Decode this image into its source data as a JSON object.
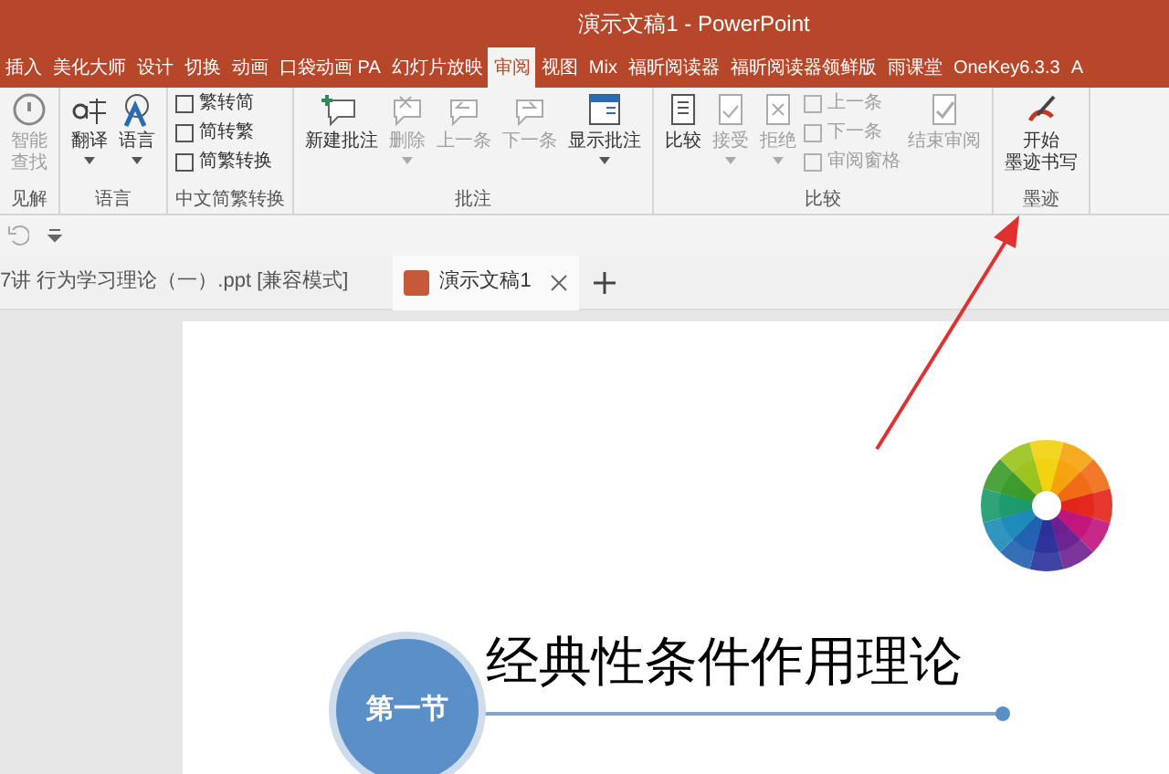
{
  "title_bar": {
    "title": "演示文稿1  -  PowerPoint"
  },
  "ribbon_tabs": [
    {
      "label": "插入",
      "selected": false
    },
    {
      "label": "美化大师",
      "selected": false
    },
    {
      "label": "设计",
      "selected": false
    },
    {
      "label": "切换",
      "selected": false
    },
    {
      "label": "动画",
      "selected": false
    },
    {
      "label": "口袋动画 PA",
      "selected": false
    },
    {
      "label": "幻灯片放映",
      "selected": false
    },
    {
      "label": "审阅",
      "selected": true
    },
    {
      "label": "视图",
      "selected": false
    },
    {
      "label": "Mix",
      "selected": false
    },
    {
      "label": "福昕阅读器",
      "selected": false
    },
    {
      "label": "福昕阅读器领鲜版",
      "selected": false
    },
    {
      "label": "雨课堂",
      "selected": false
    },
    {
      "label": "OneKey6.3.3",
      "selected": false
    },
    {
      "label": "A",
      "selected": false
    }
  ],
  "ribbon_groups": [
    {
      "label": "见解",
      "items": [
        {
          "kind": "large",
          "label_lines": [
            "智能",
            "查找"
          ],
          "disabled": true,
          "has_menu": false
        }
      ]
    },
    {
      "label": "语言",
      "items": [
        {
          "kind": "large",
          "label": "翻译",
          "disabled": false,
          "has_menu": true
        },
        {
          "kind": "large",
          "label": "语言",
          "disabled": false,
          "has_menu": true
        }
      ]
    },
    {
      "label": "中文简繁转换",
      "items": [
        {
          "kind": "small",
          "label": "繁转简",
          "disabled": false
        },
        {
          "kind": "small",
          "label": "简转繁",
          "disabled": false
        },
        {
          "kind": "small",
          "label": "简繁转换",
          "disabled": false
        }
      ]
    },
    {
      "label": "批注",
      "items": [
        {
          "kind": "large",
          "label": "新建批注",
          "disabled": false,
          "has_menu": false
        },
        {
          "kind": "large",
          "label": "删除",
          "disabled": true,
          "has_menu": true
        },
        {
          "kind": "large",
          "label": "上一条",
          "disabled": true,
          "has_menu": false
        },
        {
          "kind": "large",
          "label": "下一条",
          "disabled": true,
          "has_menu": false
        },
        {
          "kind": "large",
          "label": "显示批注",
          "disabled": false,
          "has_menu": true
        }
      ]
    },
    {
      "label": "比较",
      "items": [
        {
          "kind": "large",
          "label": "比较",
          "disabled": false,
          "has_menu": false
        },
        {
          "kind": "large",
          "label": "接受",
          "disabled": true,
          "has_menu": true
        },
        {
          "kind": "large",
          "label": "拒绝",
          "disabled": true,
          "has_menu": true
        },
        {
          "kind": "small",
          "label": "上一条",
          "disabled": true
        },
        {
          "kind": "small",
          "label": "下一条",
          "disabled": true
        },
        {
          "kind": "small",
          "label": "审阅窗格",
          "disabled": true
        },
        {
          "kind": "large",
          "label": "结束审阅",
          "disabled": true,
          "has_menu": false
        }
      ]
    },
    {
      "label": "墨迹",
      "items": [
        {
          "kind": "large",
          "label_lines": [
            "开始",
            "墨迹书写"
          ],
          "disabled": false,
          "has_menu": false
        }
      ]
    }
  ],
  "document_tabs": [
    {
      "label": "7讲 行为学习理论（一）.ppt [兼容模式]",
      "selected": false
    },
    {
      "label": "演示文稿1",
      "selected": true
    }
  ],
  "slide": {
    "badge": "第一节",
    "title": "经典性条件作用理论"
  }
}
